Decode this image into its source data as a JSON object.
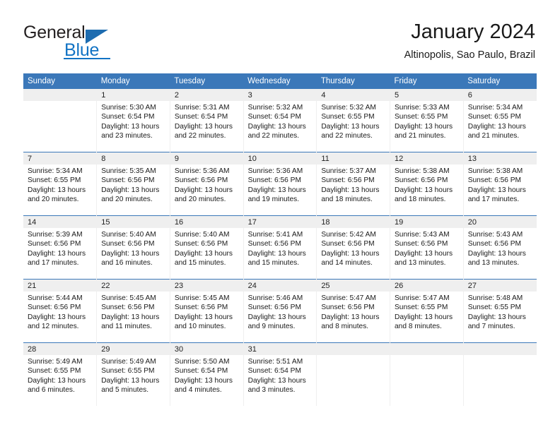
{
  "logo": {
    "word_one": "General",
    "word_two": "Blue",
    "triangle_icon": "triangle-icon"
  },
  "header": {
    "title": "January 2024",
    "subtitle": "Altinopolis, Sao Paulo, Brazil"
  },
  "colors": {
    "header_blue": "#3b78b9",
    "logo_blue": "#1273c4",
    "daynum_band": "#efefef",
    "text": "#1a1a1a"
  },
  "weekdays": [
    "Sunday",
    "Monday",
    "Tuesday",
    "Wednesday",
    "Thursday",
    "Friday",
    "Saturday"
  ],
  "labels": {
    "sunrise_prefix": "Sunrise:",
    "sunset_prefix": "Sunset:",
    "daylight_prefix": "Daylight:"
  },
  "weeks": [
    [
      {
        "day": "",
        "empty": true
      },
      {
        "day": "1",
        "sunrise": "Sunrise: 5:30 AM",
        "sunset": "Sunset: 6:54 PM",
        "daylight_a": "Daylight: 13 hours",
        "daylight_b": "and 23 minutes."
      },
      {
        "day": "2",
        "sunrise": "Sunrise: 5:31 AM",
        "sunset": "Sunset: 6:54 PM",
        "daylight_a": "Daylight: 13 hours",
        "daylight_b": "and 22 minutes."
      },
      {
        "day": "3",
        "sunrise": "Sunrise: 5:32 AM",
        "sunset": "Sunset: 6:54 PM",
        "daylight_a": "Daylight: 13 hours",
        "daylight_b": "and 22 minutes."
      },
      {
        "day": "4",
        "sunrise": "Sunrise: 5:32 AM",
        "sunset": "Sunset: 6:55 PM",
        "daylight_a": "Daylight: 13 hours",
        "daylight_b": "and 22 minutes."
      },
      {
        "day": "5",
        "sunrise": "Sunrise: 5:33 AM",
        "sunset": "Sunset: 6:55 PM",
        "daylight_a": "Daylight: 13 hours",
        "daylight_b": "and 21 minutes."
      },
      {
        "day": "6",
        "sunrise": "Sunrise: 5:34 AM",
        "sunset": "Sunset: 6:55 PM",
        "daylight_a": "Daylight: 13 hours",
        "daylight_b": "and 21 minutes."
      }
    ],
    [
      {
        "day": "7",
        "sunrise": "Sunrise: 5:34 AM",
        "sunset": "Sunset: 6:55 PM",
        "daylight_a": "Daylight: 13 hours",
        "daylight_b": "and 20 minutes."
      },
      {
        "day": "8",
        "sunrise": "Sunrise: 5:35 AM",
        "sunset": "Sunset: 6:56 PM",
        "daylight_a": "Daylight: 13 hours",
        "daylight_b": "and 20 minutes."
      },
      {
        "day": "9",
        "sunrise": "Sunrise: 5:36 AM",
        "sunset": "Sunset: 6:56 PM",
        "daylight_a": "Daylight: 13 hours",
        "daylight_b": "and 20 minutes."
      },
      {
        "day": "10",
        "sunrise": "Sunrise: 5:36 AM",
        "sunset": "Sunset: 6:56 PM",
        "daylight_a": "Daylight: 13 hours",
        "daylight_b": "and 19 minutes."
      },
      {
        "day": "11",
        "sunrise": "Sunrise: 5:37 AM",
        "sunset": "Sunset: 6:56 PM",
        "daylight_a": "Daylight: 13 hours",
        "daylight_b": "and 18 minutes."
      },
      {
        "day": "12",
        "sunrise": "Sunrise: 5:38 AM",
        "sunset": "Sunset: 6:56 PM",
        "daylight_a": "Daylight: 13 hours",
        "daylight_b": "and 18 minutes."
      },
      {
        "day": "13",
        "sunrise": "Sunrise: 5:38 AM",
        "sunset": "Sunset: 6:56 PM",
        "daylight_a": "Daylight: 13 hours",
        "daylight_b": "and 17 minutes."
      }
    ],
    [
      {
        "day": "14",
        "sunrise": "Sunrise: 5:39 AM",
        "sunset": "Sunset: 6:56 PM",
        "daylight_a": "Daylight: 13 hours",
        "daylight_b": "and 17 minutes."
      },
      {
        "day": "15",
        "sunrise": "Sunrise: 5:40 AM",
        "sunset": "Sunset: 6:56 PM",
        "daylight_a": "Daylight: 13 hours",
        "daylight_b": "and 16 minutes."
      },
      {
        "day": "16",
        "sunrise": "Sunrise: 5:40 AM",
        "sunset": "Sunset: 6:56 PM",
        "daylight_a": "Daylight: 13 hours",
        "daylight_b": "and 15 minutes."
      },
      {
        "day": "17",
        "sunrise": "Sunrise: 5:41 AM",
        "sunset": "Sunset: 6:56 PM",
        "daylight_a": "Daylight: 13 hours",
        "daylight_b": "and 15 minutes."
      },
      {
        "day": "18",
        "sunrise": "Sunrise: 5:42 AM",
        "sunset": "Sunset: 6:56 PM",
        "daylight_a": "Daylight: 13 hours",
        "daylight_b": "and 14 minutes."
      },
      {
        "day": "19",
        "sunrise": "Sunrise: 5:43 AM",
        "sunset": "Sunset: 6:56 PM",
        "daylight_a": "Daylight: 13 hours",
        "daylight_b": "and 13 minutes."
      },
      {
        "day": "20",
        "sunrise": "Sunrise: 5:43 AM",
        "sunset": "Sunset: 6:56 PM",
        "daylight_a": "Daylight: 13 hours",
        "daylight_b": "and 13 minutes."
      }
    ],
    [
      {
        "day": "21",
        "sunrise": "Sunrise: 5:44 AM",
        "sunset": "Sunset: 6:56 PM",
        "daylight_a": "Daylight: 13 hours",
        "daylight_b": "and 12 minutes."
      },
      {
        "day": "22",
        "sunrise": "Sunrise: 5:45 AM",
        "sunset": "Sunset: 6:56 PM",
        "daylight_a": "Daylight: 13 hours",
        "daylight_b": "and 11 minutes."
      },
      {
        "day": "23",
        "sunrise": "Sunrise: 5:45 AM",
        "sunset": "Sunset: 6:56 PM",
        "daylight_a": "Daylight: 13 hours",
        "daylight_b": "and 10 minutes."
      },
      {
        "day": "24",
        "sunrise": "Sunrise: 5:46 AM",
        "sunset": "Sunset: 6:56 PM",
        "daylight_a": "Daylight: 13 hours",
        "daylight_b": "and 9 minutes."
      },
      {
        "day": "25",
        "sunrise": "Sunrise: 5:47 AM",
        "sunset": "Sunset: 6:56 PM",
        "daylight_a": "Daylight: 13 hours",
        "daylight_b": "and 8 minutes."
      },
      {
        "day": "26",
        "sunrise": "Sunrise: 5:47 AM",
        "sunset": "Sunset: 6:55 PM",
        "daylight_a": "Daylight: 13 hours",
        "daylight_b": "and 8 minutes."
      },
      {
        "day": "27",
        "sunrise": "Sunrise: 5:48 AM",
        "sunset": "Sunset: 6:55 PM",
        "daylight_a": "Daylight: 13 hours",
        "daylight_b": "and 7 minutes."
      }
    ],
    [
      {
        "day": "28",
        "sunrise": "Sunrise: 5:49 AM",
        "sunset": "Sunset: 6:55 PM",
        "daylight_a": "Daylight: 13 hours",
        "daylight_b": "and 6 minutes."
      },
      {
        "day": "29",
        "sunrise": "Sunrise: 5:49 AM",
        "sunset": "Sunset: 6:55 PM",
        "daylight_a": "Daylight: 13 hours",
        "daylight_b": "and 5 minutes."
      },
      {
        "day": "30",
        "sunrise": "Sunrise: 5:50 AM",
        "sunset": "Sunset: 6:54 PM",
        "daylight_a": "Daylight: 13 hours",
        "daylight_b": "and 4 minutes."
      },
      {
        "day": "31",
        "sunrise": "Sunrise: 5:51 AM",
        "sunset": "Sunset: 6:54 PM",
        "daylight_a": "Daylight: 13 hours",
        "daylight_b": "and 3 minutes."
      },
      {
        "day": "",
        "empty": true
      },
      {
        "day": "",
        "empty": true
      },
      {
        "day": "",
        "empty": true
      }
    ]
  ]
}
